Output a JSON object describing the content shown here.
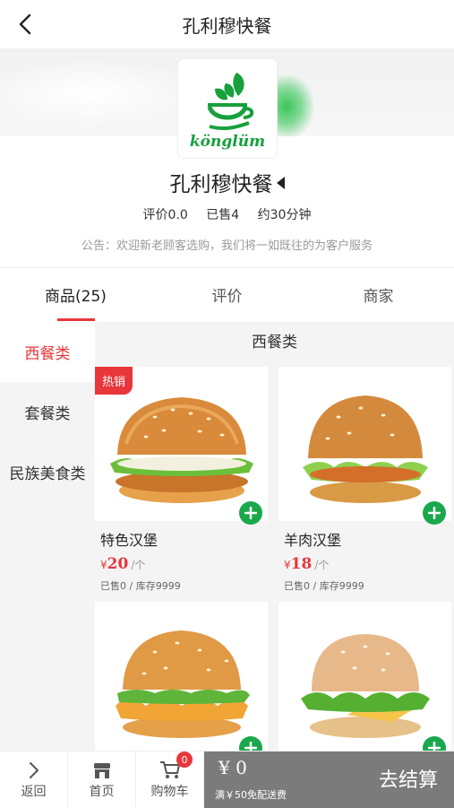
{
  "header": {
    "title": "孔利穆快餐"
  },
  "store": {
    "logo_text": "könglüm",
    "name": "孔利穆快餐",
    "rating": "评价0.0",
    "sold": "已售4",
    "delivery_time": "约30分钟",
    "notice": "公告：欢迎新老顾客选购，我们将一如既往的为客户服务"
  },
  "tabs": [
    {
      "label": "商品(25)",
      "active": true
    },
    {
      "label": "评价",
      "active": false
    },
    {
      "label": "商家",
      "active": false
    }
  ],
  "categories": [
    {
      "label": "西餐类",
      "active": true
    },
    {
      "label": "套餐类",
      "active": false
    },
    {
      "label": "民族美食类",
      "active": false
    }
  ],
  "section_title": "西餐类",
  "products": [
    {
      "name": "特色汉堡",
      "currency": "¥",
      "price": "20",
      "unit": "/个",
      "meta": "已售0 / 库存9999",
      "badge": "热销"
    },
    {
      "name": "羊肉汉堡",
      "currency": "¥",
      "price": "18",
      "unit": "/个",
      "meta": "已售0 / 库存9999",
      "badge": ""
    },
    {
      "name": "",
      "currency": "",
      "price": "",
      "unit": "",
      "meta": "",
      "badge": ""
    },
    {
      "name": "",
      "currency": "",
      "price": "",
      "unit": "",
      "meta": "",
      "badge": ""
    }
  ],
  "bottom_nav": {
    "back": "返回",
    "home": "首页",
    "cart": "购物车",
    "cart_count": "0"
  },
  "checkout": {
    "amount": "¥ 0",
    "free_delivery": "满￥50免配送费",
    "button": "去结算"
  },
  "colors": {
    "accent": "#e8363b",
    "add_button": "#1aa84c",
    "checkout_bg": "#7b7b7b"
  }
}
